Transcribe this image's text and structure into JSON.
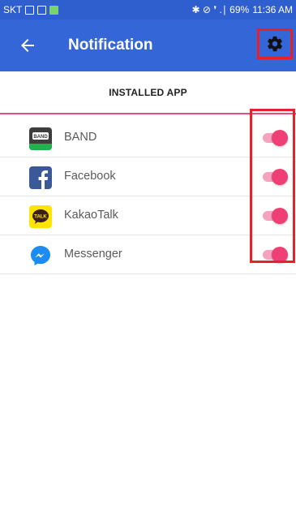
{
  "status_bar": {
    "carrier": "SKT",
    "right_text": "✱ ⊘ ❜ .∣ 69%",
    "time": "11:36 AM",
    "color": "#2f5fcf"
  },
  "app_bar": {
    "title": "Notification",
    "back_icon": "arrow-left-icon",
    "settings_icon": "gear-icon",
    "color": "#3466d8"
  },
  "tab": {
    "label": "INSTALLED APP",
    "indicator_color": "#e94b7f"
  },
  "apps": [
    {
      "name": "BAND",
      "icon": "band-icon",
      "enabled": true
    },
    {
      "name": "Facebook",
      "icon": "facebook-icon",
      "enabled": true
    },
    {
      "name": "KakaoTalk",
      "icon": "kakaotalk-icon",
      "enabled": true
    },
    {
      "name": "Messenger",
      "icon": "messenger-icon",
      "enabled": true
    }
  ],
  "band_icon_text": "BAND",
  "kakao_icon_text": "TALK",
  "toggle_color": "#ef3f76",
  "highlight_color": "#e8202a"
}
